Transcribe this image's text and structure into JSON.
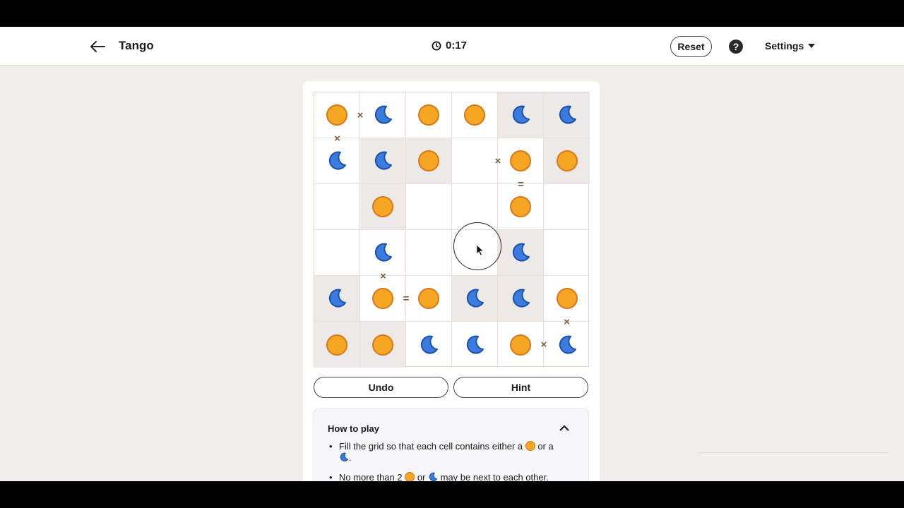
{
  "header": {
    "title": "Tango",
    "timer": "0:17",
    "reset_label": "Reset",
    "help_label": "?",
    "settings_label": "Settings"
  },
  "board": {
    "rows": 6,
    "cols": 6,
    "cells": [
      [
        "sun",
        "moon",
        "sun",
        "sun",
        "moon",
        "moon"
      ],
      [
        "moon",
        "moon",
        "sun",
        "",
        "sun",
        "sun"
      ],
      [
        "",
        "sun",
        "",
        "",
        "sun",
        ""
      ],
      [
        "",
        "moon",
        "",
        "",
        "moon",
        ""
      ],
      [
        "moon",
        "sun",
        "sun",
        "moon",
        "moon",
        "sun"
      ],
      [
        "sun",
        "sun",
        "moon",
        "moon",
        "sun",
        "moon"
      ]
    ],
    "locked": [
      [
        false,
        false,
        false,
        false,
        true,
        true
      ],
      [
        false,
        true,
        true,
        false,
        false,
        true
      ],
      [
        false,
        true,
        false,
        false,
        false,
        false
      ],
      [
        false,
        false,
        false,
        false,
        true,
        false
      ],
      [
        true,
        false,
        false,
        true,
        true,
        false
      ],
      [
        true,
        true,
        false,
        false,
        false,
        false
      ]
    ],
    "constraints": [
      {
        "between": [
          [
            0,
            0
          ],
          [
            0,
            1
          ]
        ],
        "symbol": "×"
      },
      {
        "between": [
          [
            0,
            0
          ],
          [
            1,
            0
          ]
        ],
        "symbol": "×"
      },
      {
        "between": [
          [
            1,
            3
          ],
          [
            1,
            4
          ]
        ],
        "symbol": "×"
      },
      {
        "between": [
          [
            1,
            4
          ],
          [
            2,
            4
          ]
        ],
        "symbol": "="
      },
      {
        "between": [
          [
            3,
            1
          ],
          [
            4,
            1
          ]
        ],
        "symbol": "×"
      },
      {
        "between": [
          [
            4,
            1
          ],
          [
            4,
            2
          ]
        ],
        "symbol": "="
      },
      {
        "between": [
          [
            4,
            5
          ],
          [
            5,
            5
          ]
        ],
        "symbol": "×"
      },
      {
        "between": [
          [
            5,
            4
          ],
          [
            5,
            5
          ]
        ],
        "symbol": "×"
      }
    ]
  },
  "actions": {
    "undo_label": "Undo",
    "hint_label": "Hint"
  },
  "how_to_play": {
    "title": "How to play",
    "rule1_before": "Fill the grid so that each cell contains either a ",
    "rule1_middle": " or a ",
    "rule1_after": ".",
    "rule2_before": "No more than 2 ",
    "rule2_middle": " or ",
    "rule2_after": " may be next to each other."
  },
  "colors": {
    "sun_fill": "#f5a623",
    "sun_stroke": "#d9771b",
    "moon_fill": "#3a7be0",
    "moon_stroke": "#1d4fa8",
    "locked_cell": "#ede9e6",
    "constraint": "#7a5e3a"
  },
  "icons": {
    "back": "arrow-left-icon",
    "timer": "clock-icon",
    "help": "question-circle-icon",
    "settings": "caret-down-icon",
    "collapse": "chevron-up-icon",
    "sun": "sun-icon",
    "moon": "moon-icon"
  }
}
